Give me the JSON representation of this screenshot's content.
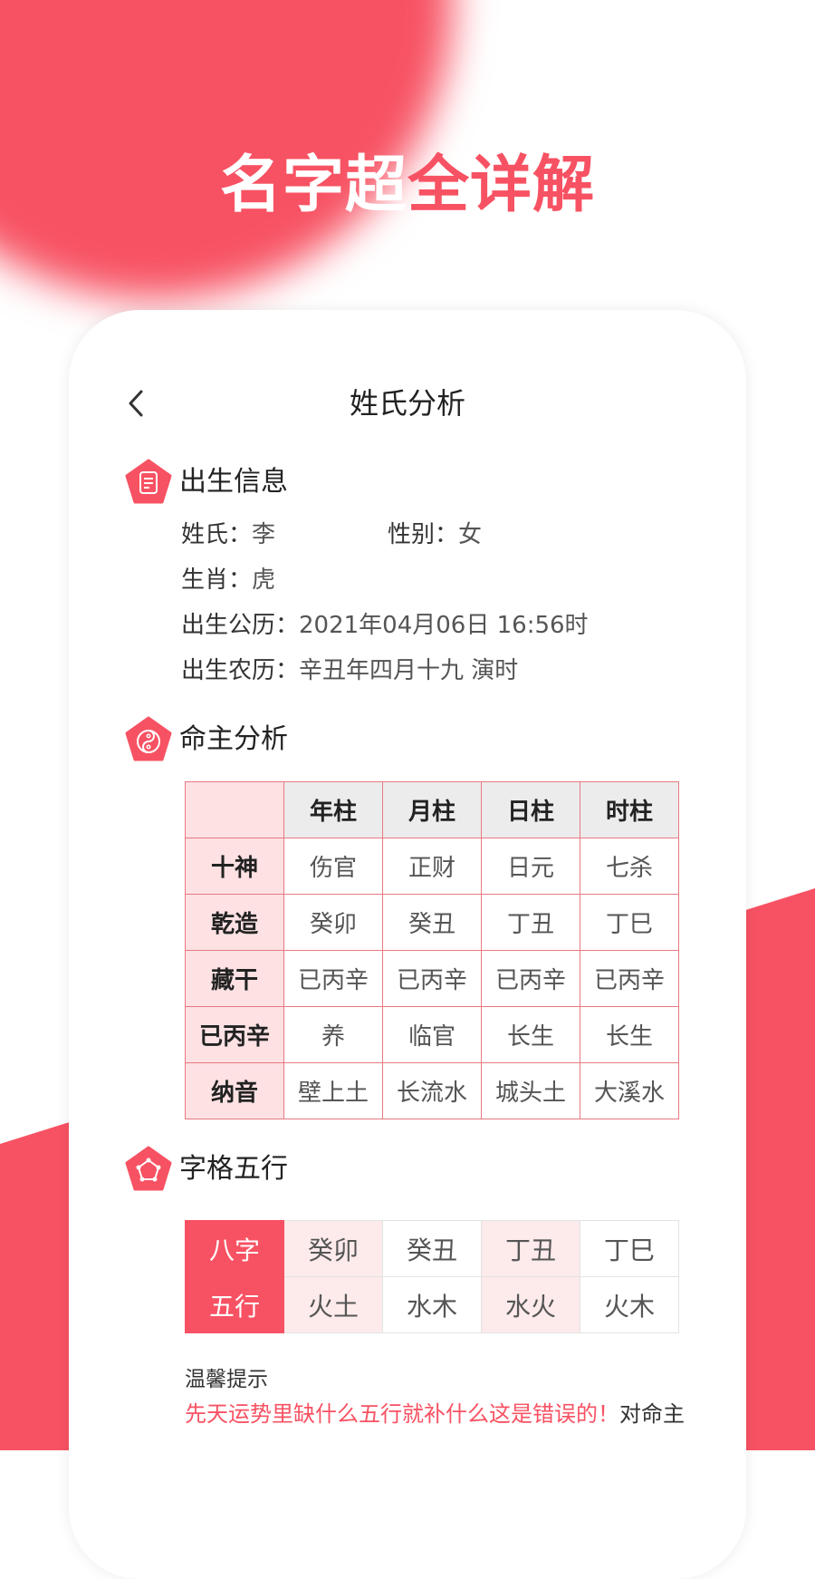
{
  "promo": {
    "title_white": "名字超",
    "title_red": "全详解",
    "accent_color": "#f75263"
  },
  "nav": {
    "back_icon": "chevron-left-icon",
    "title": "姓氏分析"
  },
  "birth_info": {
    "section_title": "出生信息",
    "icon": "document-icon",
    "surname_label": "姓氏：",
    "surname": "李",
    "gender_label": "性别：",
    "gender": "女",
    "zodiac_label": "生肖：",
    "zodiac": "虎",
    "solar_label": "出生公历：",
    "solar": "2021年04月06日 16:56时",
    "lunar_label": "出生农历：",
    "lunar": "辛丑年四月十九 演时"
  },
  "destiny": {
    "section_title": "命主分析",
    "icon": "yin-yang-icon",
    "columns": [
      "",
      "年柱",
      "月柱",
      "日柱",
      "时柱"
    ],
    "rows": [
      {
        "label": "十神",
        "cells": [
          "伤官",
          "正财",
          "日元",
          "七杀"
        ]
      },
      {
        "label": "乾造",
        "cells": [
          "癸卯",
          "癸丑",
          "丁丑",
          "丁巳"
        ]
      },
      {
        "label": "藏干",
        "cells": [
          "已丙辛",
          "已丙辛",
          "已丙辛",
          "已丙辛"
        ]
      },
      {
        "label": "已丙辛",
        "cells": [
          "养",
          "临官",
          "长生",
          "长生"
        ]
      },
      {
        "label": "纳音",
        "cells": [
          "壁上土",
          "长流水",
          "城头土",
          "大溪水"
        ]
      }
    ]
  },
  "wuxing": {
    "section_title": "字格五行",
    "icon": "pentagon-nodes-icon",
    "rows": [
      {
        "label": "八字",
        "cells": [
          "癸卯",
          "癸丑",
          "丁丑",
          "丁巳"
        ]
      },
      {
        "label": "五行",
        "cells": [
          "火土",
          "水木",
          "水火",
          "火木"
        ]
      }
    ]
  },
  "tip": {
    "heading": "温馨提示",
    "highlight": "先天运势里缺什么五行就补什么这是错误的！",
    "rest": "对命主"
  }
}
